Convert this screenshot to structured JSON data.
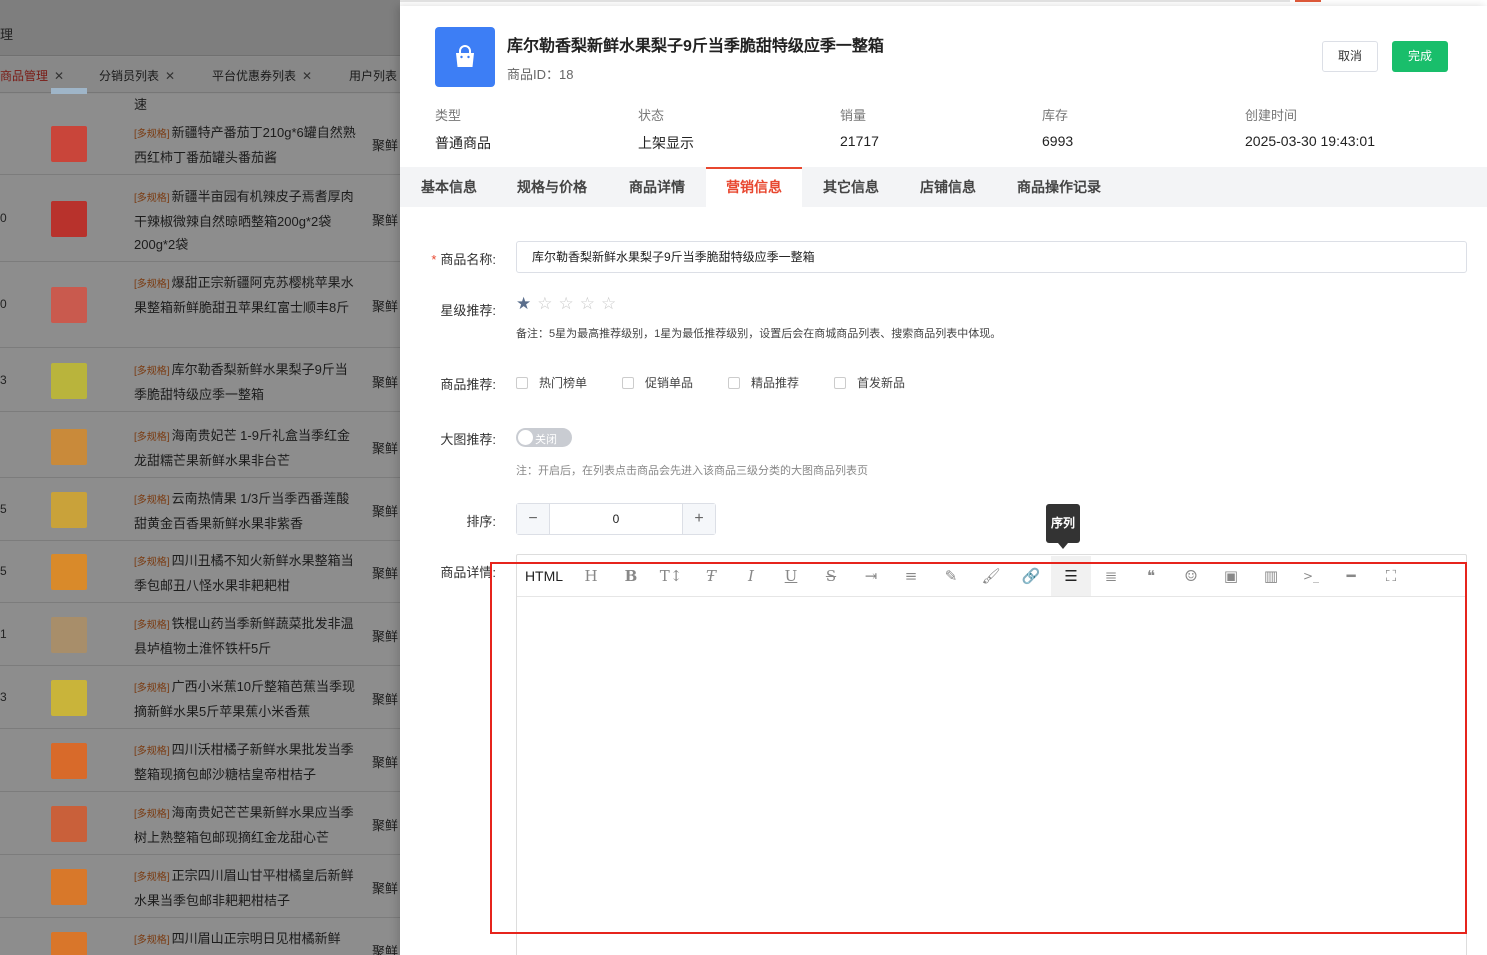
{
  "background": {
    "title_fragment": "理",
    "tabs": [
      {
        "label": "商品管理",
        "active": true
      },
      {
        "label": "分销员列表",
        "active": false
      },
      {
        "label": "平台优惠券列表",
        "active": false
      },
      {
        "label": "用户列表",
        "active": false
      }
    ],
    "first_row_tail": "速",
    "shop_fragment": "聚鲜",
    "row_indexes": [
      "",
      "0",
      "0",
      "3",
      "",
      "5",
      "5",
      "1",
      "3",
      "",
      "",
      "",
      ""
    ],
    "rows": [
      {
        "tag": "[多规格]",
        "name": "新疆特产番茄丁210g*6罐自然熟西红柿丁番茄罐头番茄酱",
        "thumb_color": "#c9453a"
      },
      {
        "tag": "[多规格]",
        "name": "新疆半亩园有机辣皮子焉耆厚肉干辣椒微辣自然晾晒整箱200g*2袋200g*2袋",
        "thumb_color": "#b8322c"
      },
      {
        "tag": "[多规格]",
        "name": "爆甜正宗新疆阿克苏樱桃苹果水果整箱新鲜脆甜丑苹果红富士顺丰8斤",
        "thumb_color": "#c95a4e"
      },
      {
        "tag": "[多规格]",
        "name": "库尔勒香梨新鲜水果梨子9斤当季脆甜特级应季一整箱",
        "thumb_color": "#b9b43c"
      },
      {
        "tag": "[多规格]",
        "name": "海南贵妃芒 1-9斤礼盒当季红金龙甜糯芒果新鲜水果非台芒",
        "thumb_color": "#c98a3a"
      },
      {
        "tag": "[多规格]",
        "name": "云南热情果 1/3斤当季西番莲酸甜黄金百香果新鲜水果非紫香",
        "thumb_color": "#c9a23a"
      },
      {
        "tag": "[多规格]",
        "name": "四川丑橘不知火新鲜水果整箱当季包邮丑八怪水果非耙耙柑",
        "thumb_color": "#d98a2a"
      },
      {
        "tag": "[多规格]",
        "name": "铁棍山药当季新鲜蔬菜批发非温县垆植物土淮怀铁杆5斤",
        "thumb_color": "#a88e6a"
      },
      {
        "tag": "[多规格]",
        "name": "广西小米蕉10斤整箱芭蕉当季现摘新鲜水果5斤苹果蕉小米香蕉",
        "thumb_color": "#c9b43a"
      },
      {
        "tag": "[多规格]",
        "name": "四川沃柑橘子新鲜水果批发当季整箱现摘包邮沙糖桔皇帝柑桔子",
        "thumb_color": "#d86a2a"
      },
      {
        "tag": "[多规格]",
        "name": "海南贵妃芒芒果新鲜水果应当季树上熟整箱包邮现摘红金龙甜心芒",
        "thumb_color": "#c9603a"
      },
      {
        "tag": "[多规格]",
        "name": "正宗四川眉山甘平柑橘皇后新鲜水果当季包邮非耙耙柑桔子",
        "thumb_color": "#d8782a"
      },
      {
        "tag": "[多规格]",
        "name": "四川眉山正宗明日见柑橘新鲜",
        "thumb_color": "#d9762a"
      }
    ]
  },
  "drawer": {
    "product_title": "库尔勒香梨新鲜水果梨子9斤当季脆甜特级应季一整箱",
    "product_id": "商品ID：18",
    "icon": "shopping-bag-icon",
    "cancel_label": "取消",
    "done_label": "完成",
    "info": [
      {
        "key": "类型",
        "value": "普通商品"
      },
      {
        "key": "状态",
        "value": "上架显示"
      },
      {
        "key": "销量",
        "value": "21717"
      },
      {
        "key": "库存",
        "value": "6993"
      },
      {
        "key": "创建时间",
        "value": "2025-03-30 19:43:01"
      }
    ],
    "tabs": [
      {
        "label": "基本信息",
        "active": false
      },
      {
        "label": "规格与价格",
        "active": false
      },
      {
        "label": "商品详情",
        "active": false
      },
      {
        "label": "营销信息",
        "active": true
      },
      {
        "label": "其它信息",
        "active": false
      },
      {
        "label": "店铺信息",
        "active": false
      },
      {
        "label": "商品操作记录",
        "active": false
      }
    ],
    "form": {
      "name_label": "商品名称:",
      "name_value": "库尔勒香梨新鲜水果梨子9斤当季脆甜特级应季一整箱",
      "stars_label": "星级推荐:",
      "stars_value": 1,
      "stars_max": 5,
      "stars_note": "备注：5星为最高推荐级别，1星为最低推荐级别，设置后会在商城商品列表、搜索商品列表中体现。",
      "recommend_label": "商品推荐:",
      "recommend_options": [
        "热门榜单",
        "促销单品",
        "精品推荐",
        "首发新品"
      ],
      "bigimg_label": "大图推荐:",
      "bigimg_switch": "关闭",
      "bigimg_note": "注：开启后，在列表点击商品会先进入该商品三级分类的大图商品列表页",
      "sort_label": "排序:",
      "sort_value": "0",
      "detail_label": "商品详情:"
    },
    "editor": {
      "html_label": "HTML",
      "tooltip": "序列",
      "tools": [
        "heading-icon",
        "bold-icon",
        "font-size-icon",
        "font-family-icon",
        "italic-icon",
        "underline-icon",
        "strikethrough-icon",
        "indent-icon",
        "line-height-icon",
        "font-color-icon",
        "background-color-icon",
        "link-icon",
        "list-icon",
        "justify-icon",
        "quote-icon",
        "emoji-icon",
        "image-icon",
        "video-icon",
        "code-icon",
        "divider-icon",
        "fullscreen-icon"
      ]
    }
  },
  "colors": {
    "accent": "#e8472f",
    "primary": "#3d7ef5",
    "success": "#19be6b",
    "highlight_box": "#e6241c"
  }
}
